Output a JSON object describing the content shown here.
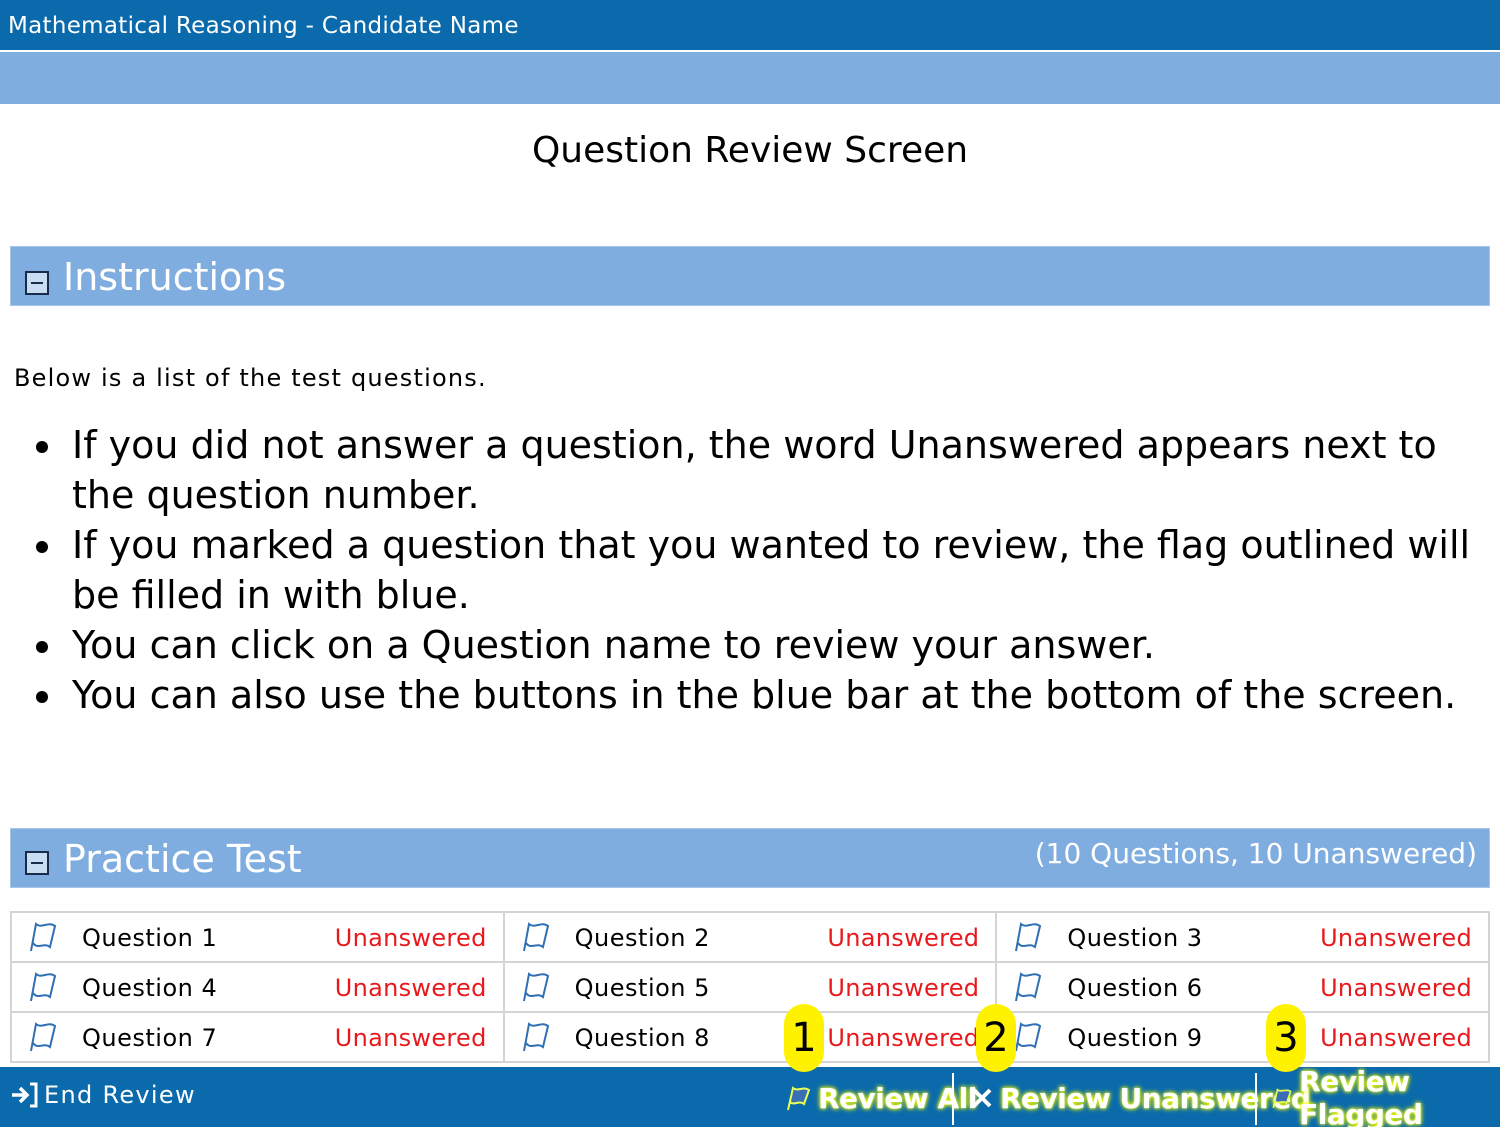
{
  "window": {
    "title": "Mathematical Reasoning - Candidate Name"
  },
  "page": {
    "title": "Question Review Screen"
  },
  "instructions": {
    "header": "Instructions",
    "intro": "Below is a list of the test questions.",
    "bullets": [
      "If you did not answer a question, the word Unanswered appears next to the question number.",
      "If you marked a question that you wanted to review, the flag outlined will be filled in with blue.",
      "You can click on a Question name to review your answer.",
      "You can also use the buttons in the blue bar at the bottom of the screen."
    ]
  },
  "practice_test": {
    "header": "Practice Test",
    "summary": "(10 Questions, 10 Unanswered)",
    "questions": [
      {
        "name": "Question 1",
        "status": "Unanswered"
      },
      {
        "name": "Question 2",
        "status": "Unanswered"
      },
      {
        "name": "Question 3",
        "status": "Unanswered"
      },
      {
        "name": "Question 4",
        "status": "Unanswered"
      },
      {
        "name": "Question 5",
        "status": "Unanswered"
      },
      {
        "name": "Question 6",
        "status": "Unanswered"
      },
      {
        "name": "Question 7",
        "status": "Unanswered"
      },
      {
        "name": "Question 8",
        "status": "Unanswered"
      },
      {
        "name": "Question 9",
        "status": "Unanswered"
      }
    ]
  },
  "bottom_bar": {
    "end_review": "End Review",
    "review_all": "Review All",
    "review_unanswered": "Review Unanswered",
    "review_flagged": "Review Flagged"
  },
  "markers": [
    "1",
    "2",
    "3"
  ],
  "icons": {
    "collapse": "minus-box-icon",
    "flag": "flag-outline-icon",
    "end_review": "exit-arrow-icon",
    "review_all": "flags-icon",
    "review_unanswered": "x-icon",
    "review_flagged": "flag-icon"
  },
  "colors": {
    "titlebar": "#0a6aab",
    "section_header": "#7fade0",
    "unanswered": "#e8191d",
    "highlight": "#fff200"
  }
}
